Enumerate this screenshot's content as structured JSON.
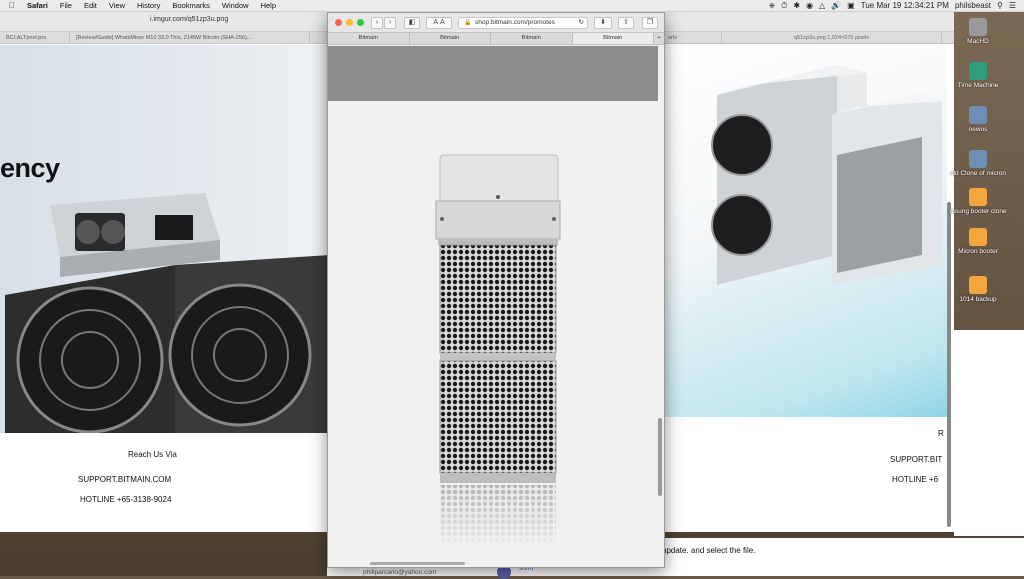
{
  "menubar": {
    "apple": "",
    "items": [
      "Safari",
      "File",
      "Edit",
      "View",
      "History",
      "Bookmarks",
      "Window",
      "Help"
    ],
    "datetime": "Tue Mar 19  12:34:21 PM",
    "user": "philsbeast"
  },
  "left_window": {
    "url": "i.imgur.com/q51zp3u.png",
    "tabs": [
      "BCI.ALTpool.pro",
      "[Review/Guide] WhatsMiner M10 33.0 Th/s, 2145W Bitcoin (SHA-256)..."
    ],
    "headline": "ency",
    "contact_title": "Reach Us Via",
    "support": "SUPPORT.BITMAIN.COM",
    "hotline": "HOTLINE +65-3138-9024"
  },
  "front_window": {
    "url": "shop.bitmain.com/promotes",
    "tabs": [
      "Bitmain",
      "Bitmain",
      "Bitmain",
      "Bitmain"
    ],
    "active_tab": 3,
    "add_tab": "+"
  },
  "right_window": {
    "title": "q51zp3u.png 1,024×576 pixels",
    "tab": "arts",
    "contact_title": "R",
    "support": "SUPPORT.BIT",
    "hotline": "HOTLINE +6"
  },
  "desktop_icons": [
    {
      "label": "MacHD",
      "color": "#9a9a9a"
    },
    {
      "label": "Time Machine",
      "color": "#2e9d7a"
    },
    {
      "label": "newos",
      "color": "#6d8fb4"
    },
    {
      "label": "old Clone of micron",
      "color": "#6d8fb4"
    },
    {
      "label": "msung booter clone",
      "color": "#f3a63b"
    },
    {
      "label": "Micron booter",
      "color": "#f3a63b"
    },
    {
      "label": "1014 backup",
      "color": "#f3a63b"
    }
  ],
  "bottom": {
    "text1": "update. and select the file.",
    "user": "sorin",
    "email": "philiparcario@yahoo.com"
  }
}
